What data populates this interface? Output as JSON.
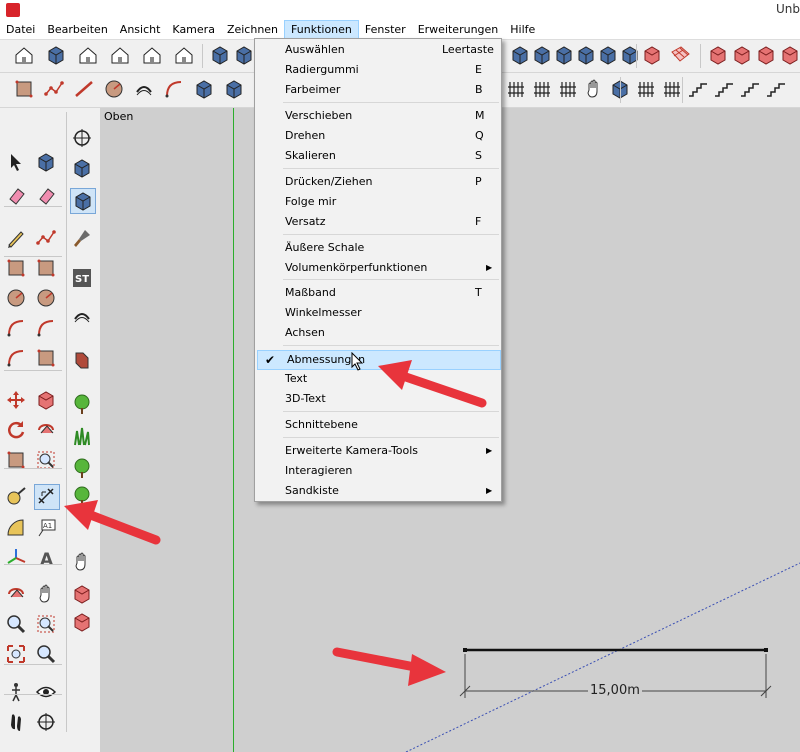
{
  "window": {
    "title": "Unb"
  },
  "menubar": [
    "Datei",
    "Bearbeiten",
    "Ansicht",
    "Kamera",
    "Zeichnen",
    "Funktionen",
    "Fenster",
    "Erweiterungen",
    "Hilfe"
  ],
  "dropdown": {
    "items": [
      {
        "label": "Auswählen",
        "shortcut": "Leertaste"
      },
      {
        "label": "Radiergummi",
        "shortcut": "E"
      },
      {
        "label": "Farbeimer",
        "shortcut": "B"
      },
      {
        "label": "Verschieben",
        "shortcut": "M"
      },
      {
        "label": "Drehen",
        "shortcut": "Q"
      },
      {
        "label": "Skalieren",
        "shortcut": "S"
      },
      {
        "label": "Drücken/Ziehen",
        "shortcut": "P"
      },
      {
        "label": "Folge mir",
        "shortcut": ""
      },
      {
        "label": "Versatz",
        "shortcut": "F"
      },
      {
        "label": "Äußere Schale",
        "shortcut": ""
      },
      {
        "label": "Volumenkörperfunktionen",
        "shortcut": ""
      },
      {
        "label": "Maßband",
        "shortcut": "T"
      },
      {
        "label": "Winkelmesser",
        "shortcut": ""
      },
      {
        "label": "Achsen",
        "shortcut": ""
      },
      {
        "label": "Abmessungen",
        "shortcut": ""
      },
      {
        "label": "Text",
        "shortcut": ""
      },
      {
        "label": "3D-Text",
        "shortcut": ""
      },
      {
        "label": "Schnittebene",
        "shortcut": ""
      },
      {
        "label": "Erweiterte Kamera-Tools",
        "shortcut": ""
      },
      {
        "label": "Interagieren",
        "shortcut": ""
      },
      {
        "label": "Sandkiste",
        "shortcut": ""
      }
    ]
  },
  "toolbar_tags": {
    "st": "ST",
    "a1": "A1"
  },
  "viewport": {
    "scene_label": "Oben",
    "dimension_text": "15,00m"
  },
  "colors": {
    "annotation_arrow": "#e8343c",
    "menu_highlight": "#cce8ff",
    "green_axis": "#2cae2c"
  }
}
